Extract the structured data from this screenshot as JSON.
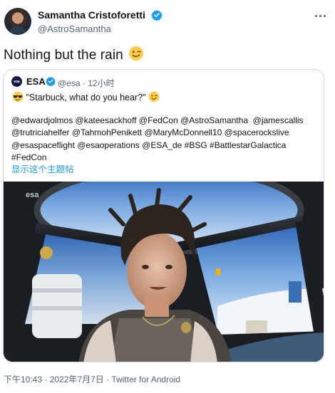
{
  "author": {
    "name": "Samantha Cristoforetti",
    "handle": "@AstroSamantha"
  },
  "tweet": {
    "text": "Nothing but the rain"
  },
  "quoted": {
    "avatar_text": "esa",
    "name": "ESA",
    "handle": "@esa",
    "separator": "·",
    "time": "12小时",
    "line1": "\"Starbuck, what do you hear?\"",
    "mentions": "@edwardjolmos @kateesackhoff @FedCon @AstroSamantha  @jamescallis\n@trutriciahelfer @TahmohPenikett @MaryMcDonnell10 @spacerockslive\n@esaspaceflight @esaoperations @ESA_de #BSG #BattlestarGalactica\n#FedCon",
    "show_thread": "显示这个主题帖",
    "media_watermark": "esa"
  },
  "footer": {
    "timestamp": "下午10:43 · 2022年7月7日 · Twitter for Android"
  },
  "colors": {
    "accent": "#1d9bf0",
    "secondary_text": "#536471",
    "border": "#cfd9de"
  },
  "icons": [
    "verified-badge-icon",
    "more-options-icon",
    "wink-emoji-icon",
    "sunglasses-emoji-icon"
  ]
}
